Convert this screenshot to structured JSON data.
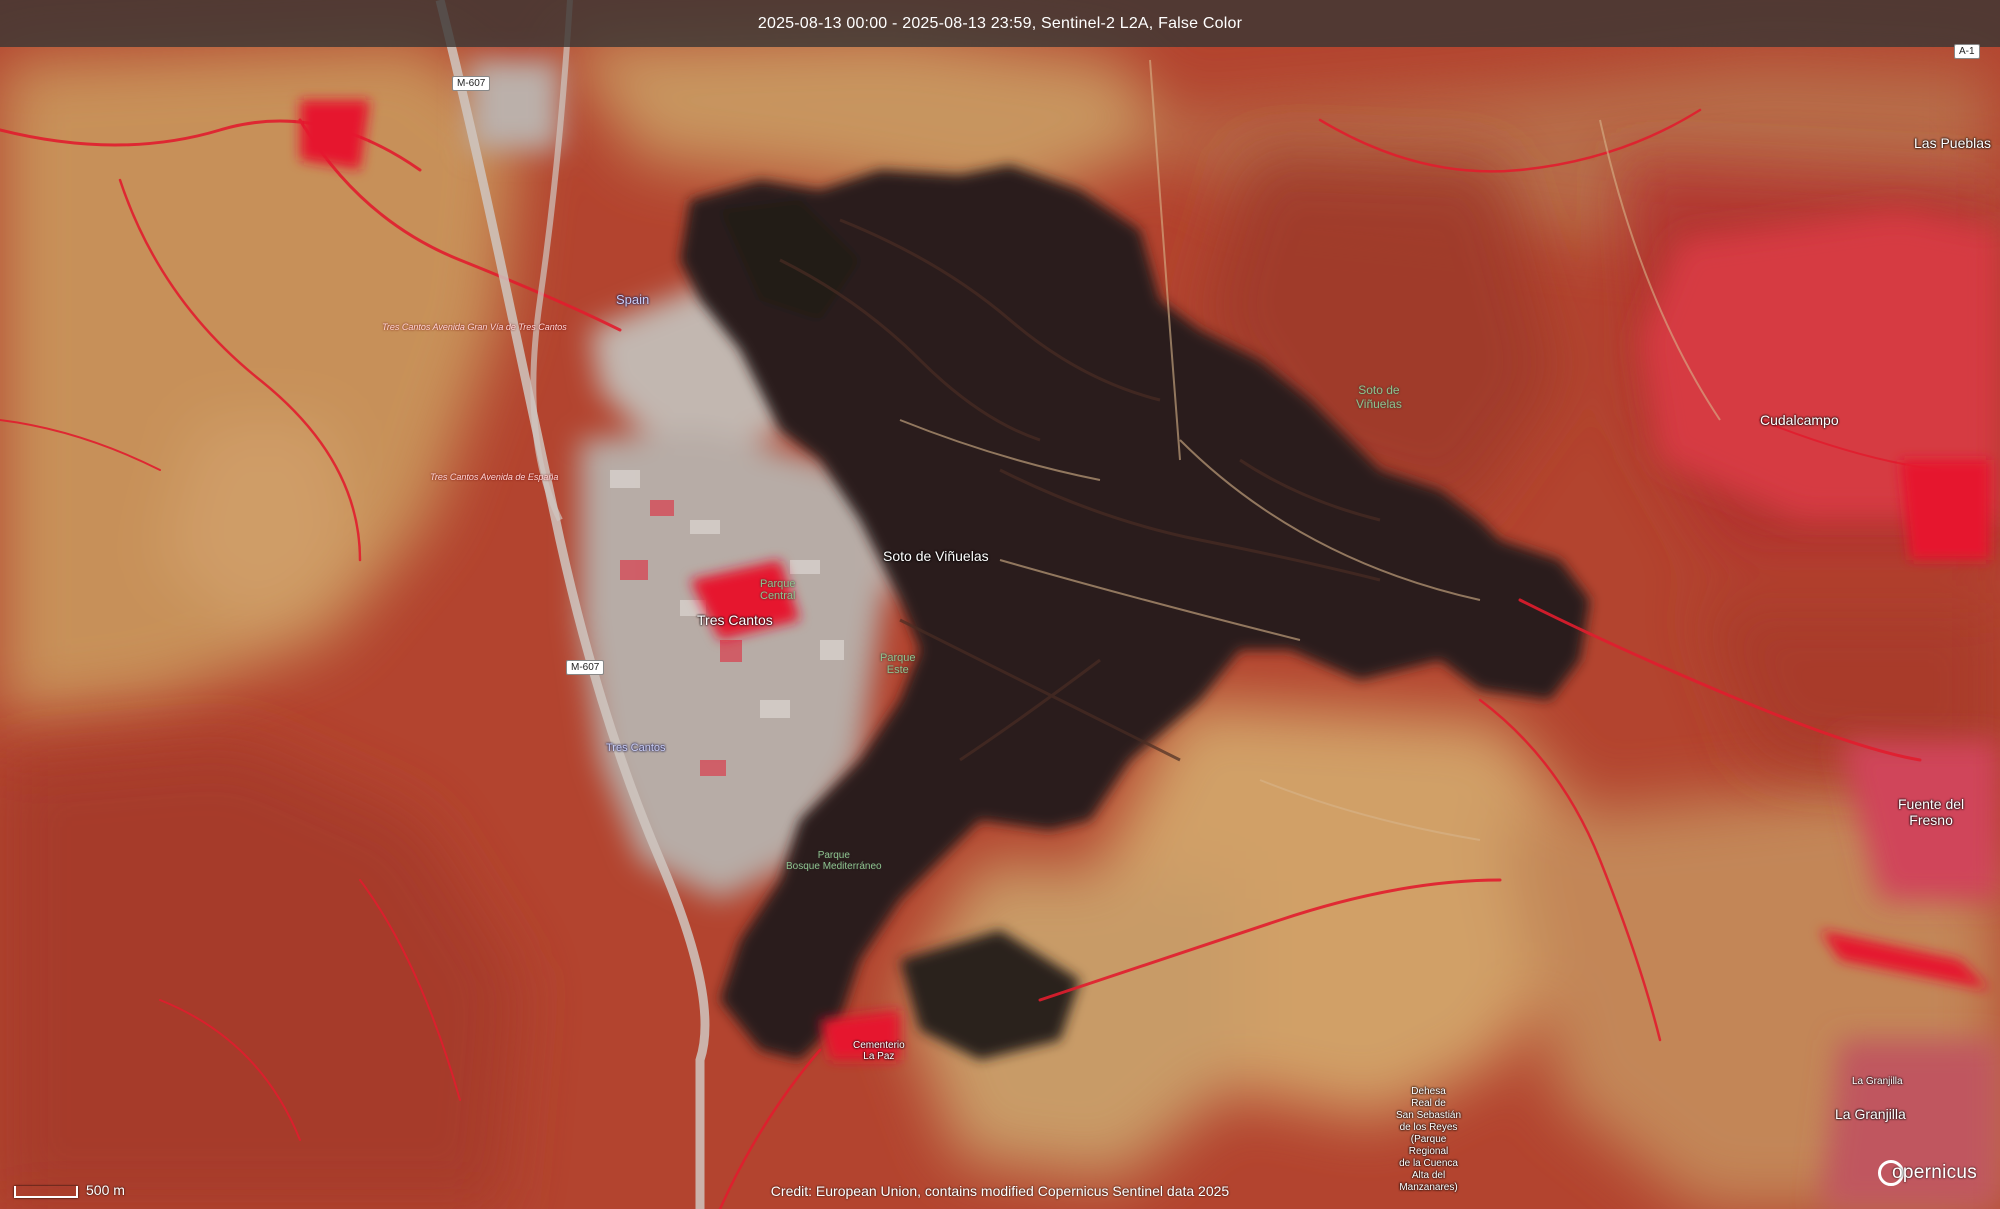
{
  "header": {
    "title": "2025-08-13 00:00 - 2025-08-13 23:59, Sentinel-2 L2A, False Color"
  },
  "scale": {
    "label": "500 m"
  },
  "credit": "Credit: European Union, contains modified Copernicus Sentinel data 2025",
  "logo": {
    "text": "opernicus"
  },
  "colors": {
    "vegetation_red": "#b3402c",
    "bright_vegetation": "#e0152e",
    "bare_soil": "#c9955b",
    "burned_area": "#2a1e19",
    "urban": "#b9b2ad",
    "header_bg": "#3c3734"
  },
  "labels": {
    "spain": "Spain",
    "tres_cantos": "Tres Cantos",
    "tres_cantos_station": "Tres Cantos",
    "soto_de_vinuelas": "Soto de Viñuelas",
    "soto_de_vinuelas_green": "Soto de\nViñuelas",
    "cudalcampo": "Cudalcampo",
    "las_pueblas": "Las Pueblas",
    "fuente_del_fresno": "Fuente del\nFresno",
    "la_granjilla": "La Granjilla",
    "la_granjilla_small": "La Granjilla",
    "parque_central": "Parque\nCentral",
    "parque_este": "Parque\nEste",
    "parque_bosque": "Parque\nBosque Mediterráneo",
    "cementerio": "Cementerio\nLa Paz",
    "dehesa": "Dehesa\nReal de\nSan Sebastián\nde los Reyes\n(Parque\nRegional\nde la Cuenca\nAlta del\nManzanares)",
    "avenida_1": "Tres Cantos Avenida Gran Vía de Tres Cantos",
    "avenida_2": "Tres Cantos Avenida de España",
    "m607_top": "M-607",
    "m607_mid": "M-607",
    "a1": "A-1"
  }
}
